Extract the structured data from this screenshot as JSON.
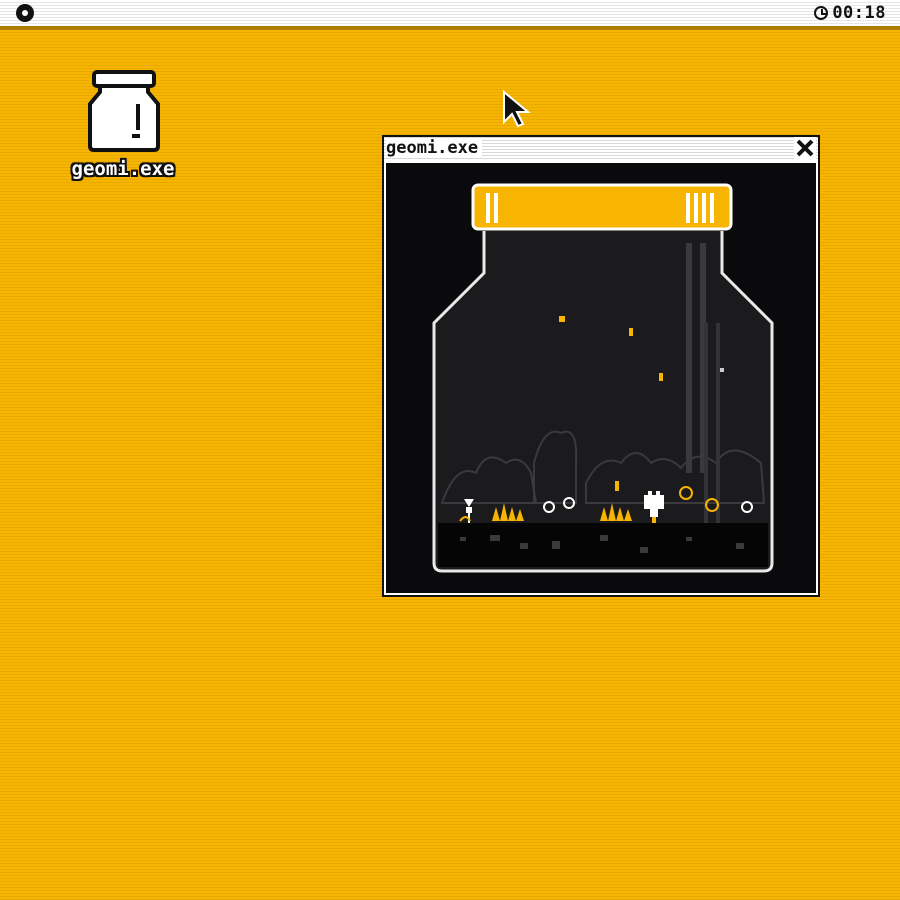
{
  "menubar": {
    "clock_time": "00:18"
  },
  "desktop": {
    "icon_label": "geomi.exe",
    "icon_name": "jar-icon"
  },
  "window": {
    "title": "geomi.exe",
    "close_icon": "close-icon",
    "scene": {
      "jar_lid_color": "#f7b400",
      "accent_color": "#f7b400"
    }
  },
  "colors": {
    "desktop_bg": "#f7b400",
    "window_bg": "#0a090b",
    "menubar_bg": "#ffffff"
  }
}
